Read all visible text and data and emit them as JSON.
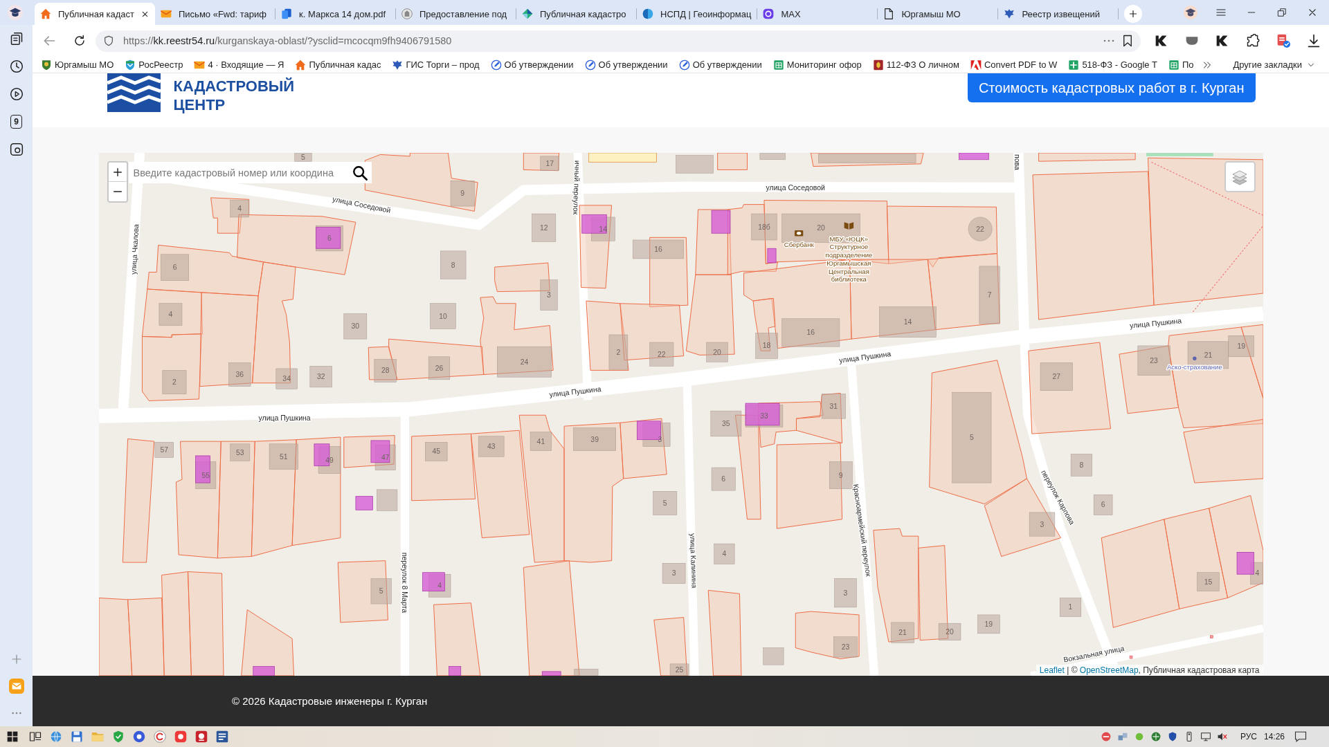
{
  "browser": {
    "tabs": [
      {
        "title": "Публичная кадаст",
        "selected": true
      },
      {
        "title": "Письмо «Fwd: тариф",
        "selected": false
      },
      {
        "title": "к. Маркса 14 дом.pdf",
        "selected": false
      },
      {
        "title": "Предоставление под",
        "selected": false
      },
      {
        "title": "Публичная кадастро",
        "selected": false
      },
      {
        "title": "НСПД | Геоинформац",
        "selected": false
      },
      {
        "title": "MAX",
        "selected": false
      },
      {
        "title": "Юргамыш МО",
        "selected": false
      },
      {
        "title": "Реестр извещений",
        "selected": false
      }
    ],
    "address": {
      "scheme": "https://",
      "host": "kk.reestr54.ru",
      "path": "/kurganskaya-oblast/?ysclid=mcocqm9fh9406791580"
    },
    "bookmarks": [
      "Юргамыш МО",
      "РосРеестр",
      "4 · Входящие — Я",
      "Публичная кадас",
      "ГИС Торги – прод",
      "Об утверждении",
      "Об утверждении",
      "Об утверждении",
      "Мониторинг офор",
      "112-ФЗ О личном",
      "Convert PDF to W",
      "518-ФЗ - Google T",
      "По"
    ],
    "other_bookmarks": "Другие закладки",
    "sidebar_badge": "9"
  },
  "page": {
    "logo_lines": [
      "КАДАСТРОВЫЙ",
      "ЦЕНТР"
    ],
    "cta_button": "Стоимость кадастровых работ в г. Курган",
    "map": {
      "search": {
        "placeholder": "Введите кадастровый номер или координа"
      },
      "streets": [
        "улица Соседовой",
        "улица Соседовой",
        "улица Чкалова",
        "ичный переулок",
        "пова",
        "улица Пушкина",
        "улица Пушкина",
        "улица Пушкина",
        "улица Пушкина",
        "переулок 8 Марта",
        "улица Калинина",
        "Красноармейский переулок",
        "переулок Карпова",
        "Вокзальная улица"
      ],
      "house_numbers": [
        "5",
        "17",
        "9",
        "4",
        "6",
        "6",
        "8",
        "12",
        "3",
        "4",
        "30",
        "10",
        "2",
        "36",
        "34",
        "32",
        "28",
        "26",
        "24",
        "14",
        "16",
        "18б",
        "20",
        "22",
        "2",
        "22",
        "20",
        "18",
        "16",
        "14",
        "7",
        "27",
        "23",
        "21",
        "19",
        "5",
        "8",
        "6",
        "3",
        "1",
        "15",
        "4",
        "21",
        "20",
        "19",
        "35",
        "33",
        "31",
        "6",
        "9",
        "4",
        "3",
        "23",
        "3",
        "5",
        "25",
        "57",
        "55",
        "53",
        "51",
        "49",
        "47",
        "45",
        "43",
        "41",
        "39",
        "3",
        "5",
        "4"
      ],
      "places": [
        {
          "lines": [
            "Сбербанк"
          ]
        },
        {
          "lines": [
            "МБУ «ЮЦК»",
            "Структурное",
            "подразделение",
            "Юргамышская",
            "Центральная",
            "библиотека"
          ]
        },
        {
          "lines": [
            "Аско-страхование"
          ]
        }
      ],
      "attribution": [
        {
          "text": "Leaflet",
          "link": true
        },
        {
          "text": " | © ",
          "link": false
        },
        {
          "text": "OpenStreetMap",
          "link": true
        },
        {
          "text": ", Публичная кадастровая карта",
          "link": false
        }
      ]
    },
    "footer": "© 2026 Кадастровые инженеры г. Курган"
  },
  "taskbar": {
    "language": "РУС",
    "time": "14:26"
  }
}
